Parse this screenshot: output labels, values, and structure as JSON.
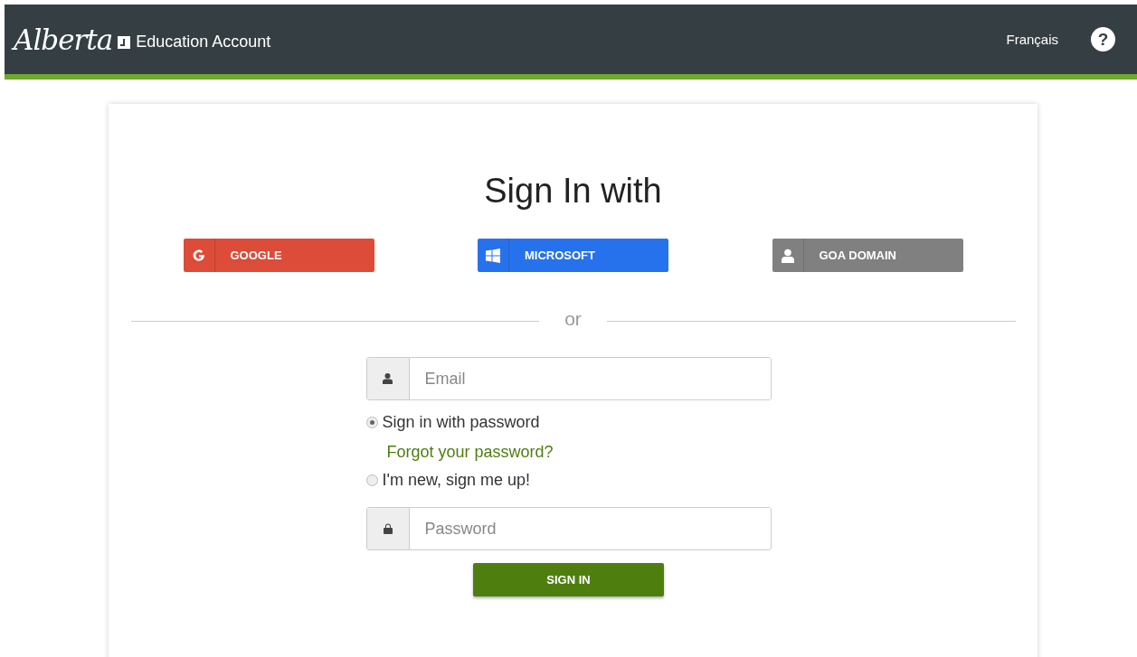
{
  "header": {
    "logo": "Alberta",
    "title": "Education Account",
    "language_link": "Français",
    "help": "?"
  },
  "sign_in": {
    "title": "Sign In with",
    "providers": [
      {
        "kind": "google",
        "label": "GOOGLE",
        "color": "#dd4b39"
      },
      {
        "kind": "microsoft",
        "label": "MICROSOFT",
        "color": "#2672ec"
      },
      {
        "kind": "domain",
        "label": "GOA DOMAIN",
        "color": "#808080"
      }
    ],
    "divider": "or",
    "email_field": {
      "placeholder": "Email"
    },
    "options": [
      {
        "label": "Sign in with password",
        "selected": true
      },
      {
        "label": "I'm new, sign me up!",
        "selected": false
      }
    ],
    "forgot_link": "Forgot your password?",
    "password_field": {
      "placeholder": "Password"
    },
    "submit": "SIGN IN"
  }
}
